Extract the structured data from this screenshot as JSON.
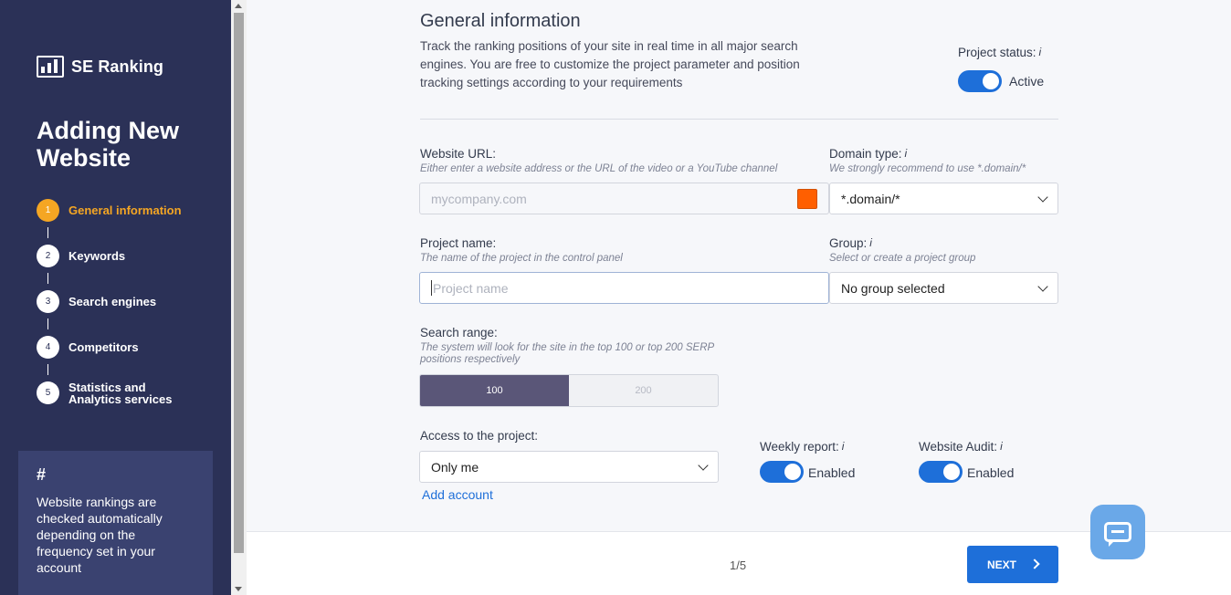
{
  "sidebar": {
    "logo_text": "SE Ranking",
    "page_title": "Adding New Website",
    "steps": [
      {
        "num": "1",
        "label": "General information",
        "active": true
      },
      {
        "num": "2",
        "label": "Keywords"
      },
      {
        "num": "3",
        "label": "Search engines"
      },
      {
        "num": "4",
        "label": "Competitors"
      },
      {
        "num": "5",
        "label": "Statistics and Analytics services"
      }
    ],
    "tip": {
      "hash": "#",
      "text": "Website rankings are checked automatically depending on the frequency set in your account"
    }
  },
  "main": {
    "title": "General information",
    "description": "Track the ranking positions of your site in real time in all major search engines. You are free to customize the project parameter and position tracking settings according to your requirements",
    "project_status": {
      "label": "Project status:",
      "info": "i",
      "value": "Active"
    },
    "website_url": {
      "label": "Website URL:",
      "hint": "Either enter a website address or the URL of the video or a YouTube channel",
      "placeholder": "mycompany.com",
      "color": "#ff5f00"
    },
    "domain_type": {
      "label": "Domain type:",
      "info": "i",
      "hint": "We strongly recommend to use *.domain/*",
      "value": "*.domain/*"
    },
    "project_name": {
      "label": "Project name:",
      "hint": "The name of the project in the control panel",
      "placeholder": "Project name"
    },
    "group": {
      "label": "Group:",
      "info": "i",
      "hint": "Select or create a project group",
      "value": "No group selected"
    },
    "search_range": {
      "label": "Search range:",
      "hint": "The system will look for the site in the top 100 or top 200 SERP positions respectively",
      "options": [
        "100",
        "200"
      ],
      "selected": "100"
    },
    "access": {
      "label": "Access to the project:",
      "value": "Only me",
      "add_link": "Add account"
    },
    "weekly_report": {
      "label": "Weekly report:",
      "info": "i",
      "value": "Enabled"
    },
    "website_audit": {
      "label": "Website Audit:",
      "info": "i",
      "value": "Enabled"
    }
  },
  "footer": {
    "pager": "1/5",
    "next_label": "NEXT"
  },
  "colors": {
    "sidebar_bg": "#2b3157",
    "accent": "#f5a623",
    "primary": "#1e6fd9"
  }
}
